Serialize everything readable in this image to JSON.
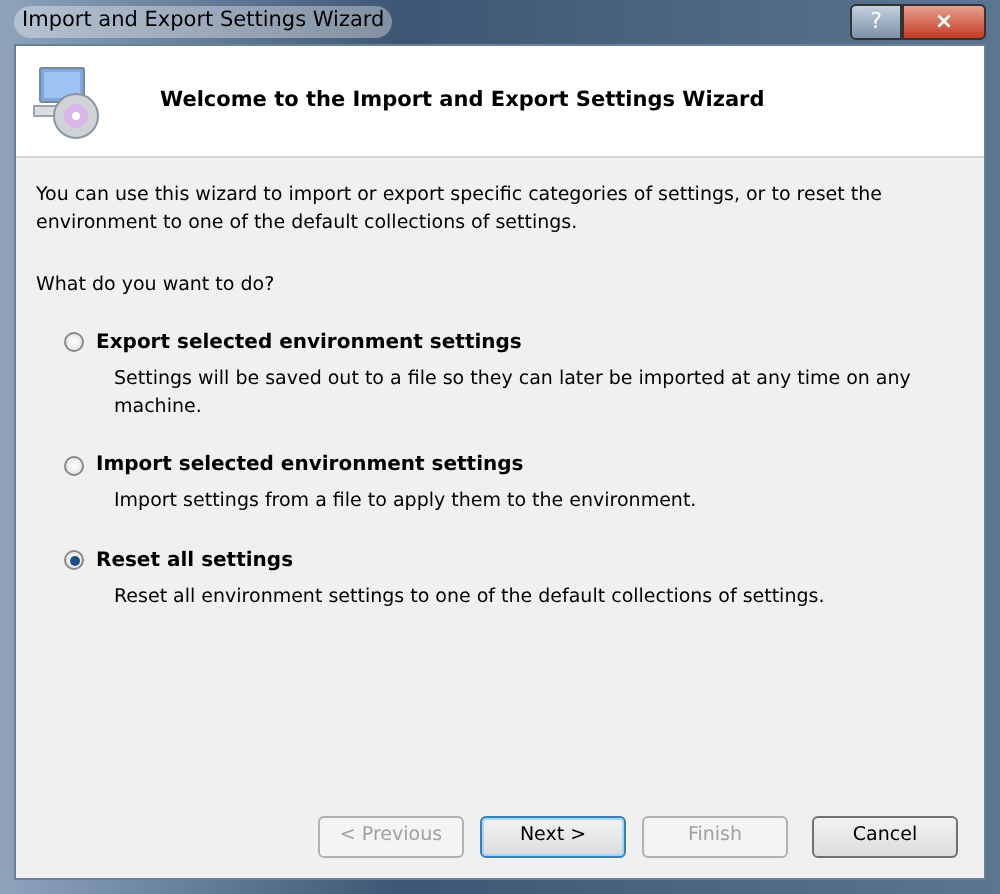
{
  "window": {
    "title": "Import and Export Settings Wizard",
    "help_label": "?",
    "close_label": "×"
  },
  "header": {
    "title": "Welcome to the Import and Export Settings Wizard"
  },
  "intro": "You can use this wizard to import or export specific categories of settings, or to reset the environment to one of the default collections of settings.",
  "question": "What do you want to do?",
  "options": [
    {
      "label": "Export selected environment settings",
      "description": "Settings will be saved out to a file so they can later be imported at any time on any machine.",
      "selected": false
    },
    {
      "label": "Import selected environment settings",
      "description": "Import settings from a file to apply them to the environment.",
      "selected": false
    },
    {
      "label": "Reset all settings",
      "description": "Reset all environment settings to one of the default collections of settings.",
      "selected": true
    }
  ],
  "buttons": [
    {
      "label": "< Previous",
      "disabled": true,
      "default": false
    },
    {
      "label": "Next >",
      "disabled": false,
      "default": true
    },
    {
      "label": "Finish",
      "disabled": true,
      "default": false
    },
    {
      "label": "Cancel",
      "disabled": false,
      "default": false
    }
  ]
}
